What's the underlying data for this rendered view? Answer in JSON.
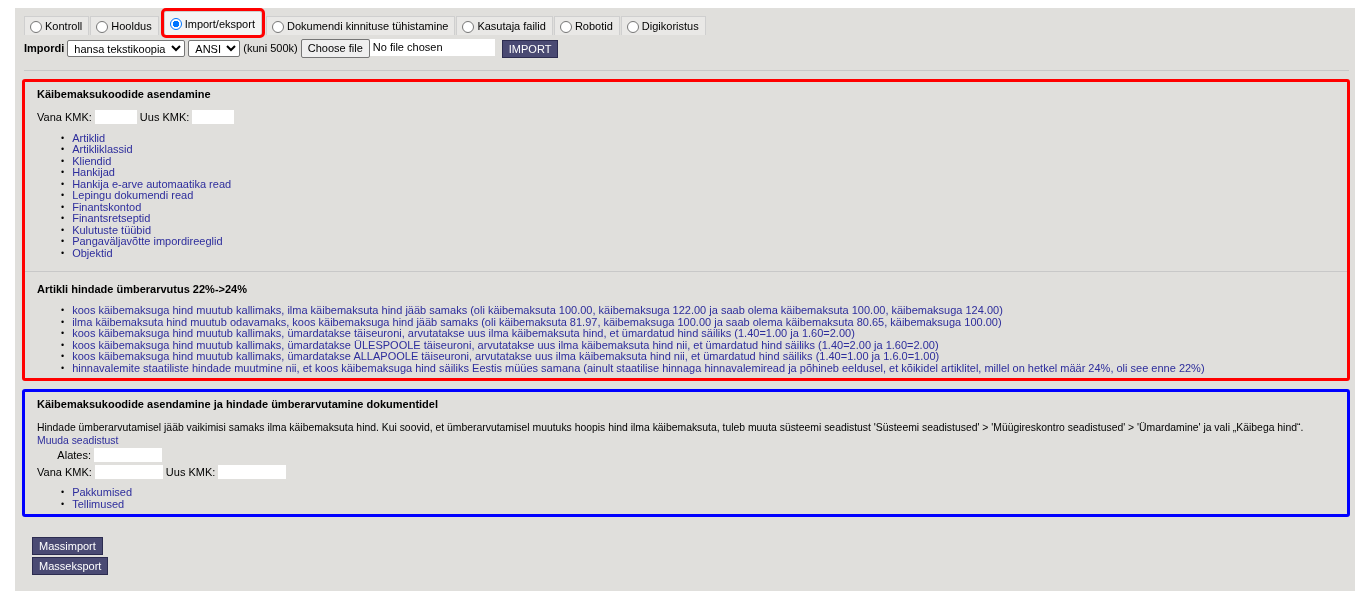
{
  "tabs": [
    {
      "label": "Kontroll",
      "selected": false,
      "highlighted": false
    },
    {
      "label": "Hooldus",
      "selected": false,
      "highlighted": false
    },
    {
      "label": "Import/eksport",
      "selected": true,
      "highlighted": true
    },
    {
      "label": "Dokumendi kinnituse tühistamine",
      "selected": false,
      "highlighted": false
    },
    {
      "label": "Kasutaja failid",
      "selected": false,
      "highlighted": false
    },
    {
      "label": "Robotid",
      "selected": false,
      "highlighted": false
    },
    {
      "label": "Digikoristus",
      "selected": false,
      "highlighted": false
    }
  ],
  "import": {
    "label": "Impordi",
    "format": "hansa tekstikoopia",
    "encoding": "ANSI",
    "size_note": "(kuni 500k)",
    "file_button": "Choose file",
    "file_status": "No file chosen",
    "button": "IMPORT"
  },
  "groups": [
    {
      "color": "#ff0000",
      "sections": [
        {
          "title": "Käibemaksukoodide asendamine",
          "bullet": "•",
          "field_rows": [
            [
              {
                "label": "Vana KMK:"
              },
              {
                "label": "Uus KMK:"
              }
            ]
          ],
          "links": [
            "Artiklid",
            "Artikliklassid",
            "Kliendid",
            "Hankijad",
            "Hankija e-arve automaatika read",
            "Lepingu dokumendi read",
            "Finantskontod",
            "Finantsretseptid",
            "Kulutuste tüübid",
            "Pangaväljavõtte impordireeglid",
            "Objektid"
          ]
        },
        {
          "title": "Artikli hindade ümberarvutus 22%->24%",
          "bullet": "•",
          "links": [
            "koos käibemaksuga hind muutub kallimaks, ilma käibemaksuta hind jääb samaks (oli käibemaksuta 100.00, käibemaksuga 122.00 ja saab olema käibemaksuta 100.00, käibemaksuga 124.00)",
            "ilma käibemaksuta hind muutub odavamaks, koos käibemaksuga hind jääb samaks (oli käibemaksuta 81.97, käibemaksuga 100.00 ja saab olema käibemaksuta 80.65, käibemaksuga 100.00)",
            "koos käibemaksuga hind muutub kallimaks, ümardatakse täiseuroni, arvutatakse uus ilma käibemaksuta hind, et ümardatud hind säiliks (1.40=1.00 ja 1.60=2.00)",
            "koos käibemaksuga hind muutub kallimaks, ümardatakse ÜLESPOOLE täiseuroni, arvutatakse uus ilma käibemaksuta hind nii, et ümardatud hind säiliks (1.40=2.00 ja 1.60=2.00)",
            "koos käibemaksuga hind muutub kallimaks, ümardatakse ALLAPOOLE täiseuroni, arvutatakse uus ilma käibemaksuta hind nii, et ümardatud hind säiliks (1.40=1.00 ja 1.6.0=1.00)",
            "hinnavalemite staatiliste hindade muutmine nii, et koos käibemaksuga hind säiliks Eestis müües samana (ainult staatilise hinnaga hinnavalemiread ja põhineb eeldusel, et kõikidel artiklitel, millel on hetkel määr 24%, oli see enne 22%)"
          ]
        }
      ]
    },
    {
      "color": "#0000ff",
      "sections": [
        {
          "title": "Käibemaksukoodide asendamine ja hindade ümberarvutamine dokumentidel",
          "text": "Hindade ümberarvutamisel jääb vaikimisi samaks ilma käibemaksuta hind. Kui soovid, et ümberarvutamisel muutuks hoopis hind ilma käibemaksuta, tuleb muuta süsteemi seadistust 'Süsteemi seadistused' > 'Müügireskontro seadistused' > 'Ümardamine' ja vali „Käibega hind“.",
          "text_link": "Muuda seadistust",
          "bullet": "•",
          "field_rows": [
            [
              {
                "label": "Alates:"
              }
            ],
            [
              {
                "label": "Vana KMK:"
              },
              {
                "label": "Uus KMK:"
              }
            ]
          ],
          "links": [
            "Pakkumised",
            "Tellimused"
          ]
        }
      ]
    }
  ],
  "bottom_buttons": [
    "Massimport",
    "Masseksport"
  ]
}
